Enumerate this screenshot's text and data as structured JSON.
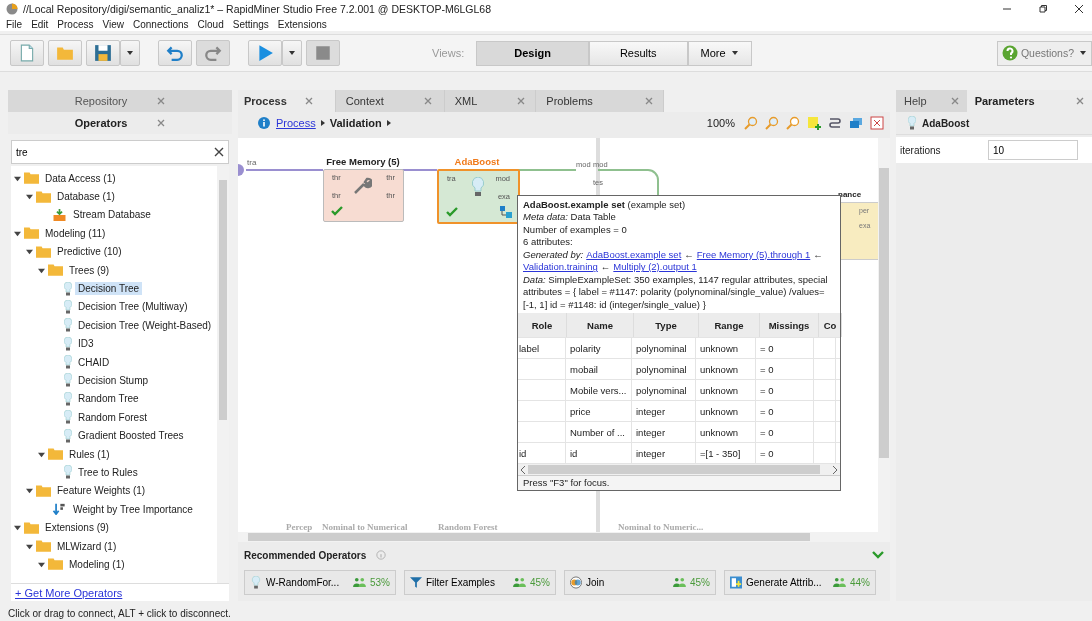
{
  "window": {
    "title": "//Local Repository/digi/semantic_analiz1* – RapidMiner Studio Free 7.2.001 @ DESKTOP-M6LGL68"
  },
  "menu": [
    "File",
    "Edit",
    "Process",
    "View",
    "Connections",
    "Cloud",
    "Settings",
    "Extensions"
  ],
  "toolbar": {
    "buttons": [
      {
        "kind": "new",
        "disabled": false
      },
      {
        "kind": "open",
        "disabled": false
      },
      {
        "kind": "save",
        "disabled": false
      },
      {
        "kind": "undo",
        "disabled": false
      },
      {
        "kind": "redo",
        "disabled": true
      },
      {
        "kind": "run",
        "disabled": false
      },
      {
        "kind": "stop",
        "disabled": true
      }
    ],
    "views_label": "Views:",
    "views": [
      {
        "label": "Design",
        "kind": "view",
        "selected": true
      },
      {
        "label": "Results",
        "kind": "view",
        "selected": false
      },
      {
        "label": "More",
        "kind": "menu",
        "selected": false
      }
    ],
    "help_button": "Questions?"
  },
  "left_panel": {
    "tabs": [
      {
        "label": "Repository",
        "selected": false
      },
      {
        "label": "Operators",
        "selected": true
      }
    ],
    "search": {
      "value": "tre"
    },
    "tree": [
      {
        "label": "Data Access (1)",
        "kind": "folder",
        "expanded": true,
        "selected": false,
        "children": [
          {
            "label": "Database (1)",
            "kind": "folder",
            "expanded": true,
            "selected": false,
            "children": [
              {
                "label": "Stream Database",
                "kind": "import",
                "selected": false
              }
            ]
          }
        ]
      },
      {
        "label": "Modeling (11)",
        "kind": "folder",
        "expanded": true,
        "selected": false,
        "children": [
          {
            "label": "Predictive (10)",
            "kind": "folder",
            "expanded": true,
            "selected": false,
            "children": [
              {
                "label": "Trees (9)",
                "kind": "folder",
                "expanded": true,
                "selected": false,
                "children": [
                  {
                    "label": "Decision Tree",
                    "kind": "learner",
                    "selected": true
                  },
                  {
                    "label": "Decision Tree (Multiway)",
                    "kind": "learner",
                    "selected": false
                  },
                  {
                    "label": "Decision Tree (Weight-Based)",
                    "kind": "learner",
                    "selected": false
                  },
                  {
                    "label": "ID3",
                    "kind": "learner",
                    "selected": false
                  },
                  {
                    "label": "CHAID",
                    "kind": "learner",
                    "selected": false
                  },
                  {
                    "label": "Decision Stump",
                    "kind": "learner",
                    "selected": false
                  },
                  {
                    "label": "Random Tree",
                    "kind": "learner",
                    "selected": false
                  },
                  {
                    "label": "Random Forest",
                    "kind": "learner",
                    "selected": false
                  },
                  {
                    "label": "Gradient Boosted Trees",
                    "kind": "learner",
                    "selected": false
                  }
                ]
              },
              {
                "label": "Rules (1)",
                "kind": "folder",
                "expanded": true,
                "selected": false,
                "children": [
                  {
                    "label": "Tree to Rules",
                    "kind": "learner",
                    "selected": false
                  }
                ]
              }
            ]
          },
          {
            "label": "Feature Weights (1)",
            "kind": "folder",
            "expanded": true,
            "selected": false,
            "children": [
              {
                "label": "Weight by Tree Importance",
                "kind": "weighting",
                "selected": false
              }
            ]
          }
        ]
      },
      {
        "label": "Extensions (9)",
        "kind": "folder",
        "expanded": true,
        "selected": false,
        "children": [
          {
            "label": "MLWizard (1)",
            "kind": "folder",
            "expanded": true,
            "selected": false,
            "children": [
              {
                "label": "Modeling (1)",
                "kind": "folder",
                "expanded": true,
                "selected": false
              }
            ]
          }
        ]
      }
    ],
    "get_more_link": "+ Get More Operators"
  },
  "center_panel": {
    "tabs": [
      {
        "label": "Process",
        "selected": true
      },
      {
        "label": "Context",
        "selected": false
      },
      {
        "label": "XML",
        "selected": false
      },
      {
        "label": "Problems",
        "selected": false
      }
    ],
    "breadcrumb": [
      {
        "label": "Process",
        "kind": "link"
      },
      {
        "label": "Validation",
        "kind": "current"
      }
    ],
    "zoom": "100%",
    "canvas": {
      "input_port": "tra",
      "nodes": [
        {
          "name": "Free Memory (5)",
          "kind": "utility",
          "selected": false,
          "ports_in": [
            "thr",
            "thr"
          ],
          "ports_out": [
            "thr",
            "thr"
          ]
        },
        {
          "name": "AdaBoost",
          "kind": "learner",
          "selected": true,
          "ports_in": [
            "tra"
          ],
          "ports_out": [
            "mod",
            "exa"
          ]
        }
      ],
      "subprocess_ports": [
        "mod",
        "mod",
        "tes"
      ],
      "partial_node": {
        "name": "nance",
        "ports": [
          "per",
          "exa"
        ]
      },
      "bottom_labels": [
        "Percep",
        "Nominal to Numerical",
        "Random Forest",
        "Nominal to Numeric..."
      ]
    },
    "tooltip": {
      "title": "**AdaBoost.example set** (example set)",
      "lines": [
        "*Meta data:* Data Table",
        "Number of examples = 0",
        "6 attributes:"
      ],
      "generated_by": {
        "label": "Generated by:",
        "parts": [
          {
            "kind": "link",
            "text": "AdaBoost.example set"
          },
          {
            "kind": "arrow",
            "text": "←"
          },
          {
            "kind": "link",
            "text": "Free Memory (5).through 1"
          },
          {
            "kind": "arrow",
            "text": "←"
          },
          {
            "kind": "link",
            "text": "Validation.training"
          },
          {
            "kind": "arrow",
            "text": "←"
          },
          {
            "kind": "link",
            "text": "Multiply (2).output 1"
          }
        ]
      },
      "data": "*Data:* SimpleExampleSet: 350 examples, 1147 regular attributes, special attributes = { label = #1147: polarity (polynominal/single_value) /values=[-1, 1] id = #1148: id (integer/single_value) }",
      "table": {
        "columns": [
          "Role",
          "Name",
          "Type",
          "Range",
          "Missings",
          "Co"
        ],
        "rows": [
          [
            "label",
            "polarity",
            "polynominal",
            "unknown",
            "= 0"
          ],
          [
            "",
            "mobail",
            "polynominal",
            "unknown",
            "= 0"
          ],
          [
            "",
            "Mobile vers...",
            "polynominal",
            "unknown",
            "= 0"
          ],
          [
            "",
            "price",
            "integer",
            "unknown",
            "= 0"
          ],
          [
            "",
            "Number of ...",
            "integer",
            "unknown",
            "= 0"
          ],
          [
            "id",
            "id",
            "integer",
            "=[1 - 350]",
            "= 0"
          ]
        ]
      },
      "footer": "Press \"F3\" for focus."
    },
    "recommended": {
      "title": "Recommended Operators",
      "items": [
        {
          "label": "W-RandomFor...",
          "kind": "learner",
          "share": "53%"
        },
        {
          "label": "Filter Examples",
          "kind": "filter",
          "share": "45%"
        },
        {
          "label": "Join",
          "kind": "join",
          "share": "45%"
        },
        {
          "label": "Generate Attrib...",
          "kind": "generate",
          "share": "44%"
        }
      ]
    }
  },
  "right_panel": {
    "tabs": [
      {
        "label": "Help",
        "selected": false
      },
      {
        "label": "Parameters",
        "selected": true
      }
    ],
    "operator": "AdaBoost",
    "parameters": [
      {
        "name": "iterations",
        "value": "10"
      }
    ]
  },
  "status_bar": "Click or drag to connect, ALT + click to disconnect."
}
